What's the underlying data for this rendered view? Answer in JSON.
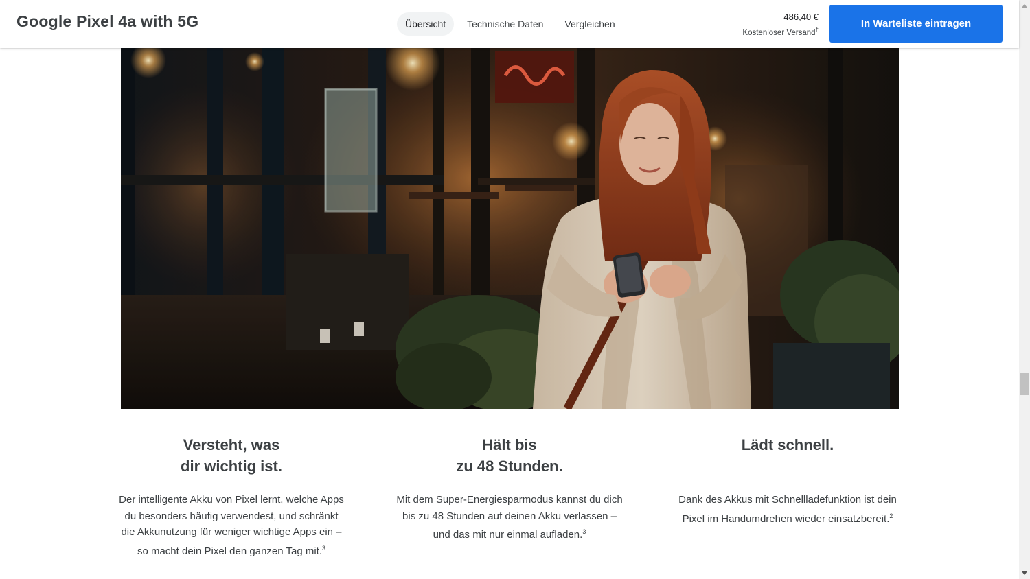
{
  "header": {
    "title": "Google Pixel 4a with 5G",
    "tabs": [
      {
        "label": "Übersicht",
        "active": true
      },
      {
        "label": "Technische Daten",
        "active": false
      },
      {
        "label": "Vergleichen",
        "active": false
      }
    ],
    "price": "486,40 €",
    "shipping": "Kostenloser Versand",
    "shipping_note": "†",
    "cta_label": "In Warteliste eintragen"
  },
  "colors": {
    "accent": "#1a73e8",
    "text": "#3c4043"
  },
  "hero": {
    "image": "woman-with-phone-at-night-photo"
  },
  "features": [
    {
      "title_line1": "Versteht, was",
      "title_line2": "dir wichtig ist.",
      "text": "Der intelligente Akku von Pixel lernt, welche Apps du besonders häufig verwendest, und schränkt die Akkunutzung für weniger wichtige Apps ein – so macht dein Pixel den ganzen Tag mit.",
      "footnote": "3"
    },
    {
      "title_line1": "Hält bis",
      "title_line2": "zu 48 Stunden.",
      "text": "Mit dem Super-Energiesparmodus kannst du dich bis zu 48 Stunden auf deinen Akku verlassen – und das mit nur einmal aufladen.",
      "footnote": "3"
    },
    {
      "title_line1": "Lädt schnell.",
      "title_line2": "",
      "text": "Dank des Akkus mit Schnellladefunktion ist dein Pixel im Handumdrehen wieder einsatzbereit.",
      "footnote": "2"
    }
  ]
}
